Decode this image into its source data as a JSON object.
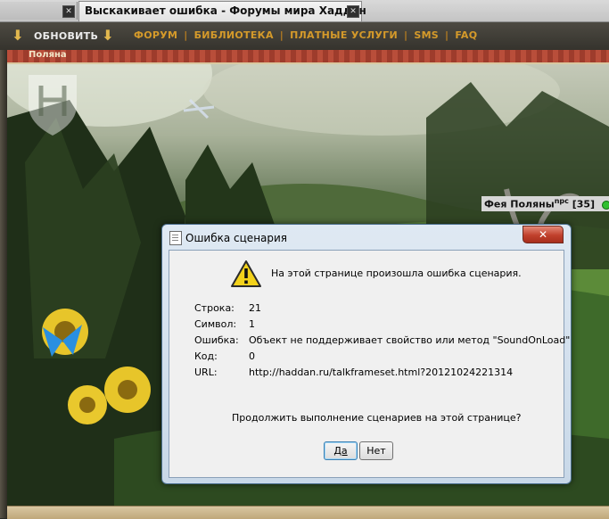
{
  "browser": {
    "active_tab_title": "Выскакивает ошибка - Форумы мира Хаддан",
    "close_glyph": "✕"
  },
  "navbar": {
    "refresh_label": "ОБНОВИТЬ",
    "links": [
      "ФОРУМ",
      "БИБЛИОТЕКА",
      "ПЛАТНЫЕ УСЛУГИ",
      "SMS",
      "FAQ"
    ],
    "separator": "|",
    "arrow_glyph": "⬇"
  },
  "location": {
    "label": "Поляна"
  },
  "npc": {
    "name": "Фея Поляны",
    "tag": "npc",
    "level": "[35]",
    "status_color": "#2fbf2f"
  },
  "dialog": {
    "title": "Ошибка сценария",
    "close_glyph": "✕",
    "message": "На этой странице произошла ошибка сценария.",
    "rows": [
      {
        "label": "Строка:",
        "value": "21"
      },
      {
        "label": "Символ:",
        "value": "1"
      },
      {
        "label": "Ошибка:",
        "value": "Объект не поддерживает свойство или метод \"SoundOnLoad\""
      },
      {
        "label": "Код:",
        "value": "0"
      },
      {
        "label": "URL:",
        "value": "http://haddan.ru/talkframeset.html?20121024221314"
      }
    ],
    "question": "Продолжить выполнение сценариев на этой странице?",
    "yes_label": "Да",
    "no_label": "Нет"
  }
}
